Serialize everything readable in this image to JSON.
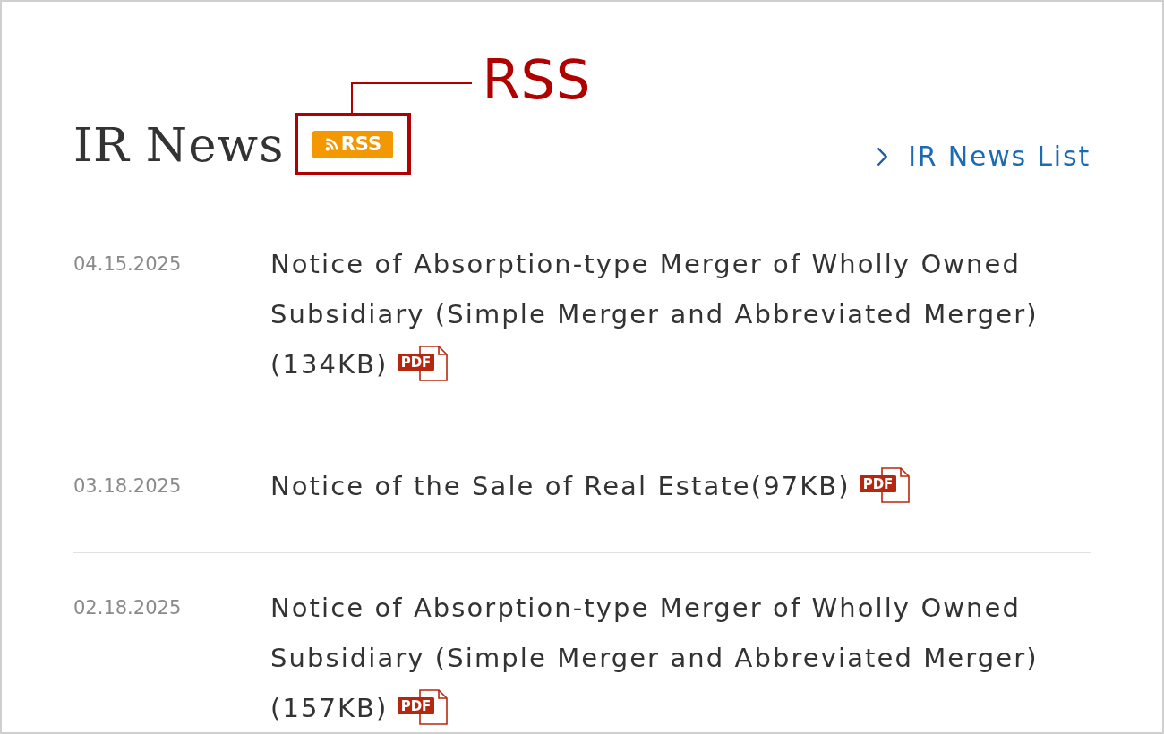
{
  "header": {
    "title": "IR News",
    "rss_button": {
      "label": "RSS"
    },
    "callout": {
      "label": "RSS"
    },
    "list_link": {
      "label": "IR News List"
    }
  },
  "news": [
    {
      "date": "04.15.2025",
      "title": "Notice of Absorption-type Merger of Wholly Owned Subsidiary (Simple Merger and Abbreviated Merger) (134KB)",
      "file_label": "PDF"
    },
    {
      "date": "03.18.2025",
      "title": "Notice of the Sale of Real Estate(97KB)",
      "file_label": "PDF"
    },
    {
      "date": "02.18.2025",
      "title": "Notice of Absorption-type Merger of Wholly Owned Subsidiary (Simple Merger and Abbreviated Merger) (157KB)",
      "file_label": "PDF"
    }
  ]
}
